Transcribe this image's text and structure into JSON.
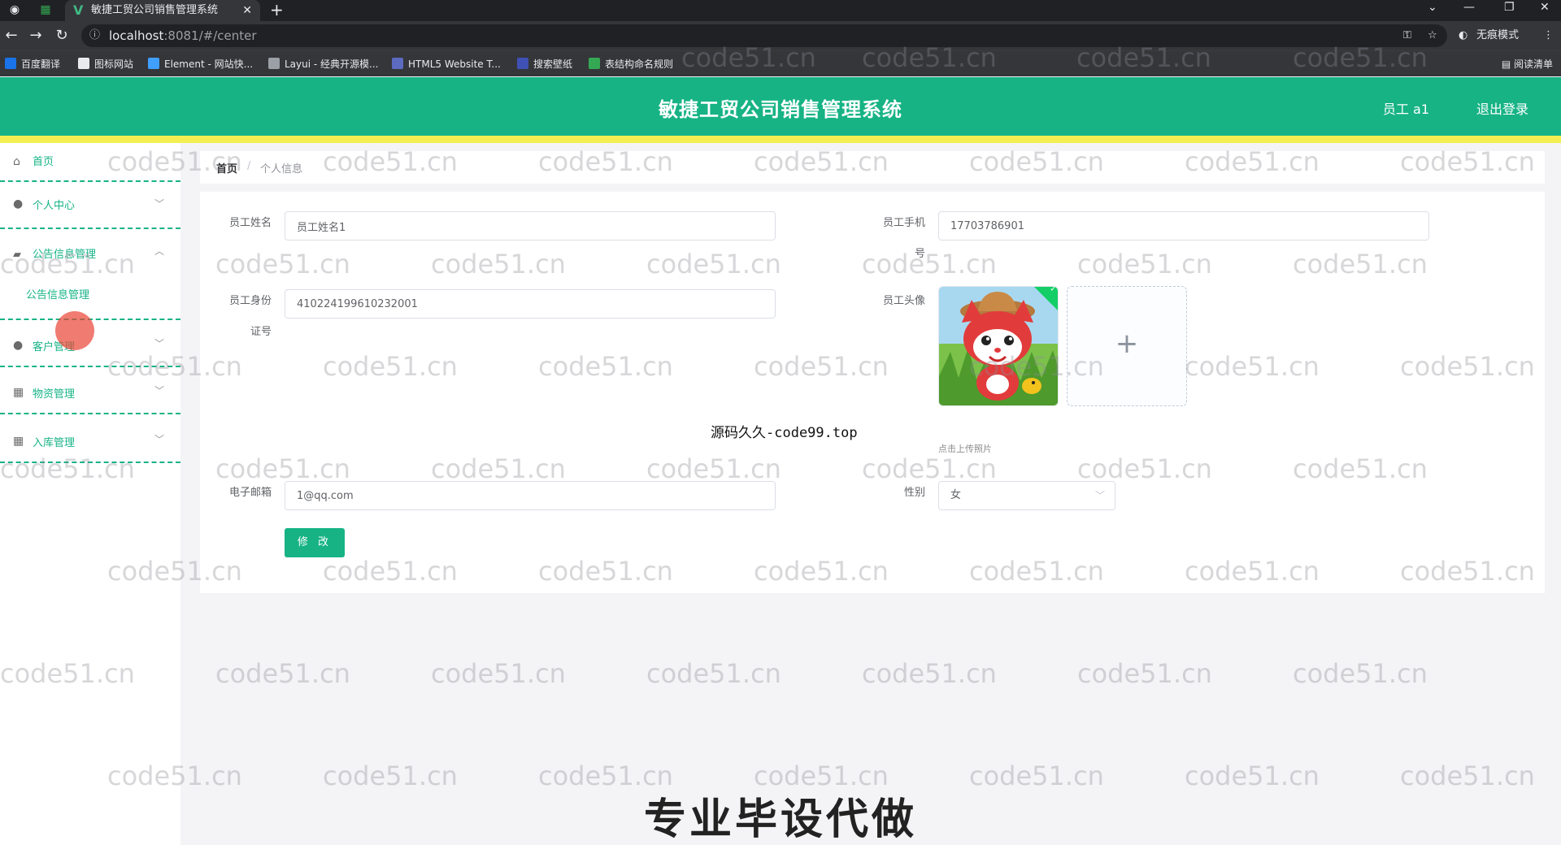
{
  "browser": {
    "tab_title": "敏捷工贸公司销售管理系统",
    "url_host": "localhost",
    "url_path": ":8081/#/center",
    "incognito_label": "无痕模式",
    "bookmarks": [
      "百度翻译",
      "图标网站",
      "Element - 网站快...",
      "Layui - 经典开源模...",
      "HTML5 Website T...",
      "搜索壁纸",
      "表结构命名规则"
    ],
    "reading_list": "阅读清单"
  },
  "header": {
    "title": "敏捷工贸公司销售管理系统",
    "user": "员工 a1",
    "logout": "退出登录"
  },
  "sidebar": {
    "items": [
      {
        "label": "首页"
      },
      {
        "label": "个人中心"
      },
      {
        "label": "公告信息管理"
      },
      {
        "label": "公告信息管理"
      },
      {
        "label": "客户管理"
      },
      {
        "label": "物资管理"
      },
      {
        "label": "入库管理"
      }
    ]
  },
  "breadcrumb": {
    "home": "首页",
    "separator": "/",
    "current": "个人信息"
  },
  "form": {
    "name_label": "员工姓名",
    "name_value": "员工姓名1",
    "phone_label_1": "员工手机",
    "phone_label_2": "号",
    "phone_value": "17703786901",
    "id_label_1": "员工身份",
    "id_label_2": "证号",
    "id_value": "410224199610232001",
    "avatar_label": "员工头像",
    "upload_tip": "点击上传照片",
    "email_label": "电子邮箱",
    "email_value": "1@qq.com",
    "gender_label": "性别",
    "gender_value": "女",
    "submit_label": "修 改"
  },
  "watermark": "code51.cn",
  "overlay_text": "源码久久-code99.top",
  "overlay_caption": "专业毕设代做",
  "colors": {
    "primary": "#17b385",
    "accent_bar": "#f4ee53",
    "click_dot": "#ea4335"
  }
}
